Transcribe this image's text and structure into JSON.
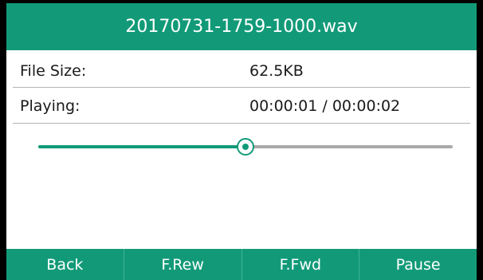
{
  "title": "20170731-1759-1000.wav",
  "info": [
    {
      "label": "File Size:",
      "value": "62.5KB"
    },
    {
      "label": "Playing:",
      "value": "00:00:01 / 00:00:02"
    }
  ],
  "progress": {
    "fraction": 0.5
  },
  "softkeys": [
    "Back",
    "F.Rew",
    "F.Fwd",
    "Pause"
  ],
  "colors": {
    "accent": "#129a78",
    "track": "#a9a9a9",
    "divider": "#b4b4b4"
  }
}
